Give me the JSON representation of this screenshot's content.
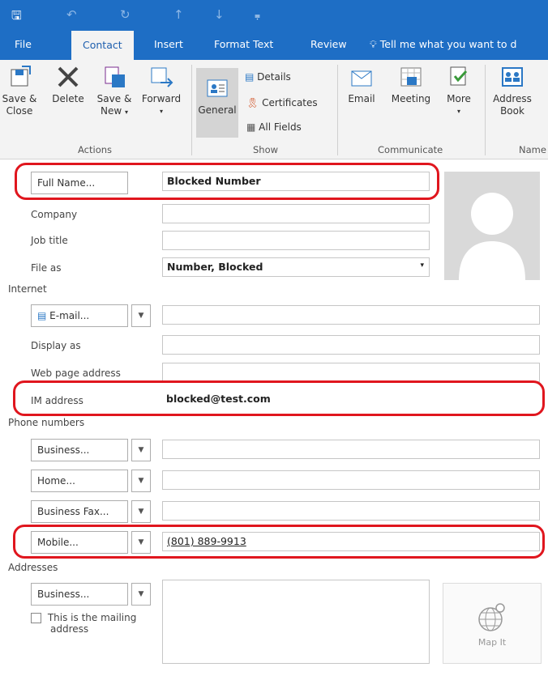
{
  "quick_access": {
    "save": "🖫",
    "undo": "↶",
    "redo": "↻",
    "up": "↑",
    "down": "↓",
    "customize": "⩦"
  },
  "tabs": [
    {
      "label": "File"
    },
    {
      "label": "Contact"
    },
    {
      "label": "Insert"
    },
    {
      "label": "Format Text"
    },
    {
      "label": "Review"
    }
  ],
  "tell_me": "Tell me what you want to d",
  "ribbon": {
    "actions": {
      "save_close": [
        "Save &",
        "Close"
      ],
      "delete": "Delete",
      "save_new": [
        "Save &",
        "New"
      ],
      "forward": "Forward",
      "group": "Actions"
    },
    "show": {
      "general": "General",
      "details": "Details",
      "certificates": "Certificates",
      "all_fields": "All Fields",
      "group": "Show"
    },
    "communicate": {
      "email": "Email",
      "meeting": "Meeting",
      "more": "More",
      "group": "Communicate"
    },
    "names": {
      "address_book": [
        "Address",
        "Book"
      ],
      "group": "Name"
    }
  },
  "form": {
    "full_name_btn": "Full Name...",
    "full_name": "Blocked Number",
    "company_label": "Company",
    "company": "",
    "job_title_label": "Job title",
    "job_title": "",
    "file_as_label": "File as",
    "file_as": "Number, Blocked",
    "internet_section": "Internet",
    "email_btn": "E-mail...",
    "email": "",
    "display_as_label": "Display as",
    "display_as": "",
    "web_label": "Web page address",
    "web": "",
    "im_label": "IM address",
    "im": "blocked@test.com",
    "phone_section": "Phone numbers",
    "phones": [
      {
        "btn": "Business...",
        "value": ""
      },
      {
        "btn": "Home...",
        "value": ""
      },
      {
        "btn": "Business Fax...",
        "value": ""
      },
      {
        "btn": "Mobile...",
        "value": "(801) 889-9913"
      }
    ],
    "addresses_section": "Addresses",
    "address_btn": "Business...",
    "mailing_check": [
      "This is the mailing",
      "address"
    ],
    "map_it": "Map It"
  },
  "colors": {
    "accent": "#1e6ec5",
    "highlight": "#e0161e"
  }
}
